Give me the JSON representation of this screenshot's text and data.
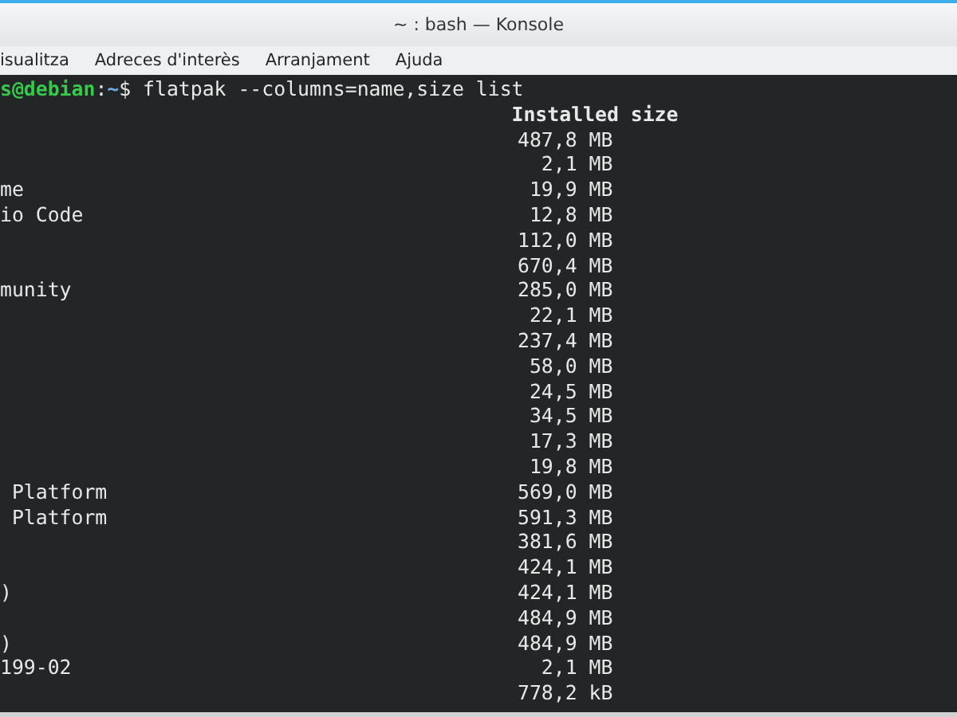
{
  "window": {
    "title": "~ : bash — Konsole"
  },
  "menu": [
    "isualitza",
    "Adreces d'interès",
    "Arranjament",
    "Ajuda"
  ],
  "terminal": {
    "prompt": {
      "user_host": "s@debian",
      "separator": ":",
      "path": "~",
      "symbol": "$",
      "command": "flatpak --columns=name,size list"
    },
    "header": {
      "column_2": "Installed size"
    },
    "rows": [
      {
        "name": "",
        "size": "487,8 MB"
      },
      {
        "name": "",
        "size": "2,1 MB"
      },
      {
        "name": "me",
        "size": "19,9 MB"
      },
      {
        "name": "io Code",
        "size": "12,8 MB"
      },
      {
        "name": "",
        "size": "112,0 MB"
      },
      {
        "name": "",
        "size": "670,4 MB"
      },
      {
        "name": "munity",
        "size": "285,0 MB"
      },
      {
        "name": "",
        "size": "22,1 MB"
      },
      {
        "name": "",
        "size": "237,4 MB"
      },
      {
        "name": "",
        "size": "58,0 MB"
      },
      {
        "name": "",
        "size": "24,5 MB"
      },
      {
        "name": "",
        "size": "34,5 MB"
      },
      {
        "name": "",
        "size": "17,3 MB"
      },
      {
        "name": "",
        "size": "19,8 MB"
      },
      {
        "name": " Platform",
        "size": "569,0 MB"
      },
      {
        "name": " Platform",
        "size": "591,3 MB"
      },
      {
        "name": "",
        "size": "381,6 MB"
      },
      {
        "name": "",
        "size": "424,1 MB"
      },
      {
        "name": ")",
        "size": "424,1 MB"
      },
      {
        "name": "",
        "size": "484,9 MB"
      },
      {
        "name": ")",
        "size": "484,9 MB"
      },
      {
        "name": "199-02",
        "size": "2,1 MB"
      },
      {
        "name": "",
        "size": "778,2 kB"
      }
    ]
  }
}
